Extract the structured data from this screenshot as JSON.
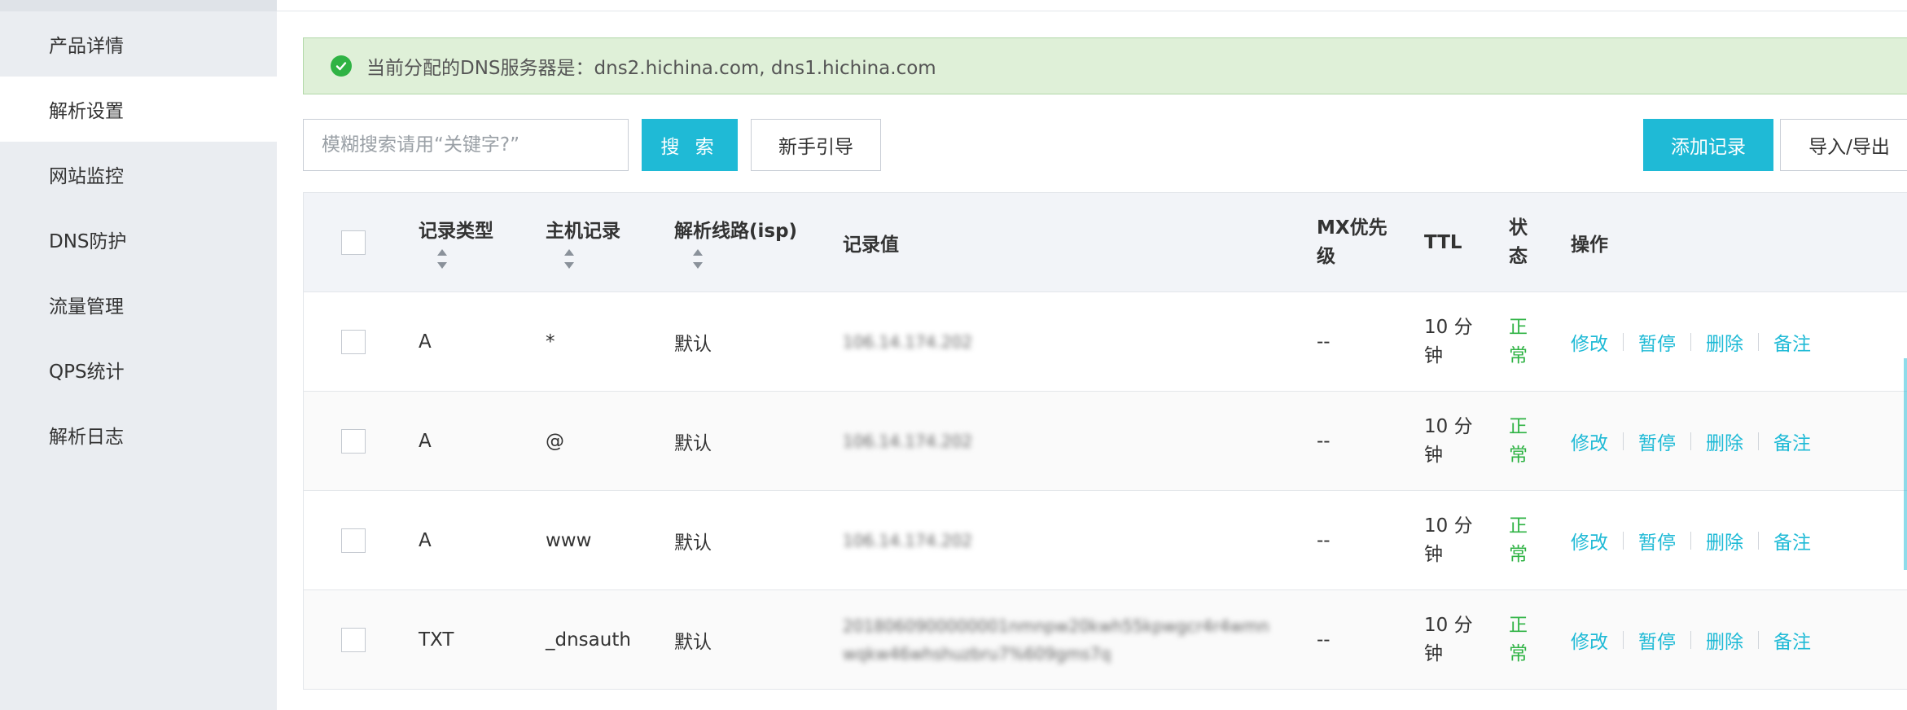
{
  "sidebar": {
    "items": [
      {
        "label": "产品详情",
        "active": false
      },
      {
        "label": "解析设置",
        "active": true
      },
      {
        "label": "网站监控",
        "active": false
      },
      {
        "label": "DNS防护",
        "active": false
      },
      {
        "label": "流量管理",
        "active": false
      },
      {
        "label": "QPS统计",
        "active": false
      },
      {
        "label": "解析日志",
        "active": false
      }
    ]
  },
  "notice": {
    "text": "当前分配的DNS服务器是：dns2.hichina.com, dns1.hichina.com",
    "icon": "check-circle-icon",
    "color": "#2fb344"
  },
  "toolbar": {
    "search_placeholder": "模糊搜索请用“关键字?”",
    "search_label": "搜 索",
    "guide_label": "新手引导",
    "add_label": "添加记录",
    "import_export_label": "导入/导出"
  },
  "table": {
    "headers": {
      "type": "记录类型",
      "host": "主机记录",
      "line": "解析线路(isp)",
      "value": "记录值",
      "mx": "MX优先级",
      "ttl": "TTL",
      "status": "状态",
      "ops": "操作"
    },
    "rows": [
      {
        "type": "A",
        "host": "*",
        "line": "默认",
        "value": "106.14.174.202",
        "mx": "--",
        "ttl": "10 分钟",
        "status": "正常"
      },
      {
        "type": "A",
        "host": "@",
        "line": "默认",
        "value": "106.14.174.202",
        "mx": "--",
        "ttl": "10 分钟",
        "status": "正常"
      },
      {
        "type": "A",
        "host": "www",
        "line": "默认",
        "value": "106.14.174.202",
        "mx": "--",
        "ttl": "10 分钟",
        "status": "正常"
      },
      {
        "type": "TXT",
        "host": "_dnsauth",
        "line": "默认",
        "value": "2018060900000001nmnpw20kwh55kpwgcr4r4wmnwqkw46whshuzbru7%609gms7q",
        "mx": "--",
        "ttl": "10 分钟",
        "status": "正常"
      }
    ],
    "ops": {
      "edit": "修改",
      "pause": "暂停",
      "delete": "删除",
      "note": "备注"
    }
  },
  "colors": {
    "accent": "#1fbad6",
    "success": "#2fb344",
    "notice_bg": "#dff0d8",
    "sidebar_bg": "#eaedf1"
  }
}
